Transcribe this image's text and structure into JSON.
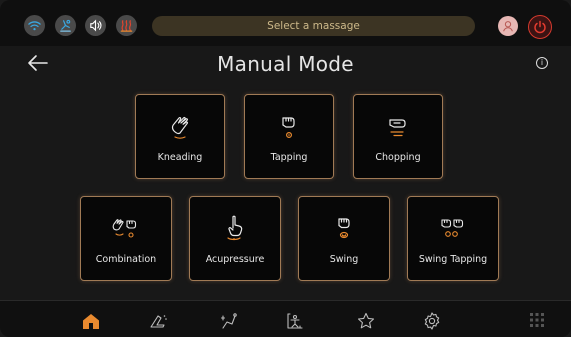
{
  "status_bar": {
    "select_placeholder": "Select a massage",
    "icons": [
      "wifi-icon",
      "zero-gravity-icon",
      "volume-icon",
      "heat-icon",
      "user-avatar-icon",
      "power-icon"
    ]
  },
  "header": {
    "title": "Manual Mode",
    "info_glyph": "i"
  },
  "modes_row1": [
    {
      "label": "Kneading",
      "icon": "kneading-icon"
    },
    {
      "label": "Tapping",
      "icon": "tapping-icon"
    },
    {
      "label": "Chopping",
      "icon": "chopping-icon"
    }
  ],
  "modes_row2": [
    {
      "label": "Combination",
      "icon": "combination-icon"
    },
    {
      "label": "Acupressure",
      "icon": "acupressure-icon"
    },
    {
      "label": "Swing",
      "icon": "swing-icon"
    },
    {
      "label": "Swing Tapping",
      "icon": "swing-tapping-icon"
    }
  ],
  "bottom_nav": {
    "items": [
      "home-icon",
      "recline-icon",
      "stretch-icon",
      "body-scan-icon",
      "favorites-icon",
      "settings-icon",
      "apps-grid-icon"
    ],
    "active": "home-icon"
  },
  "colors": {
    "accent": "#e98a2f",
    "card_border": "#a07a55",
    "power": "#d63a2e"
  }
}
